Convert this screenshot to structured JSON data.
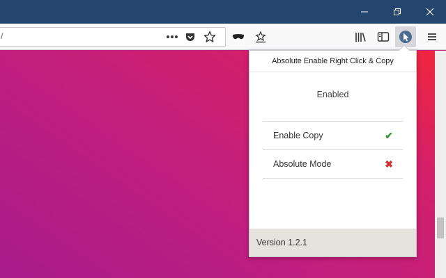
{
  "browser": {
    "url": "/",
    "title_bar_color": "#24456d",
    "window_controls": [
      "minimize-icon",
      "restore-icon",
      "close-icon"
    ],
    "toolbar_icons": [
      "more-dots-icon",
      "pocket-icon",
      "bookmark-star-icon",
      "mask-icon",
      "save-to-icon",
      "library-icon",
      "sidebar-icon",
      "extension-cursor-icon",
      "hamburger-menu-icon"
    ]
  },
  "popup": {
    "title": "Absolute Enable Right Click & Copy",
    "status": "Enabled",
    "options": [
      {
        "label": "Enable Copy",
        "state": "✔",
        "state_color": "#3a9a3a"
      },
      {
        "label": "Absolute Mode",
        "state": "✖",
        "state_color": "#d33030"
      }
    ],
    "version": "Version 1.2.1"
  }
}
